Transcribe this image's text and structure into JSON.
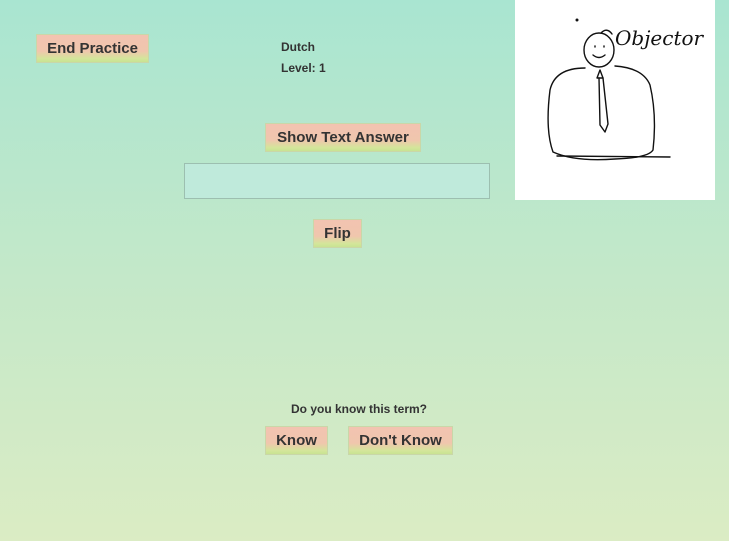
{
  "header": {
    "end_practice_label": "End Practice",
    "language": "Dutch",
    "level": "Level: 1"
  },
  "card": {
    "show_text_answer_label": "Show Text Answer",
    "answer_value": "",
    "flip_label": "Flip"
  },
  "drawing": {
    "handwritten_text": "Objector"
  },
  "prompt": {
    "question": "Do you know this term?",
    "know_label": "Know",
    "dont_know_label": "Don't Know"
  }
}
